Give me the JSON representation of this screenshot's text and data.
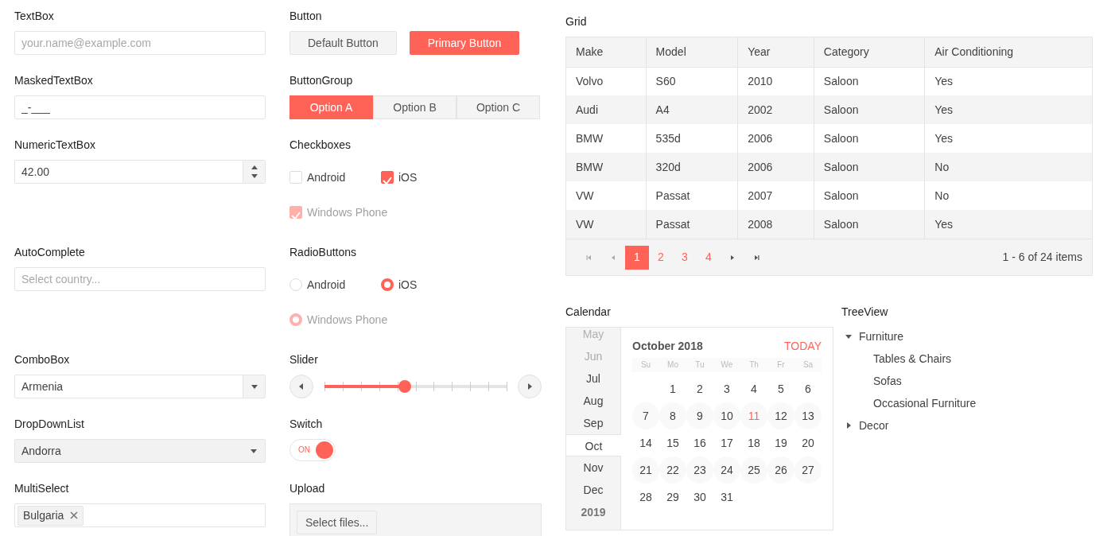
{
  "textbox": {
    "label": "TextBox",
    "placeholder": "your.name@example.com"
  },
  "button": {
    "label": "Button",
    "buttons": [
      {
        "text": "Default Button",
        "kind": "default"
      },
      {
        "text": "Primary Button",
        "kind": "primary"
      }
    ]
  },
  "masked_textbox": {
    "label": "MaskedTextBox",
    "value": "_-___"
  },
  "button_group": {
    "label": "ButtonGroup",
    "options": [
      {
        "text": "Option A",
        "selected": true
      },
      {
        "text": "Option B",
        "selected": false
      },
      {
        "text": "Option C",
        "selected": false
      }
    ]
  },
  "numeric_textbox": {
    "label": "NumericTextBox",
    "value": "42.00"
  },
  "checkboxes": {
    "label": "Checkboxes",
    "items": [
      {
        "text": "Android",
        "checked": false,
        "disabled": false
      },
      {
        "text": "iOS",
        "checked": true,
        "disabled": false
      },
      {
        "text": "Windows Phone",
        "checked": true,
        "disabled": true
      }
    ]
  },
  "autocomplete": {
    "label": "AutoComplete",
    "placeholder": "Select country..."
  },
  "radio_buttons": {
    "label": "RadioButtons",
    "items": [
      {
        "text": "Android",
        "selected": false,
        "disabled": false
      },
      {
        "text": "iOS",
        "selected": true,
        "disabled": false
      },
      {
        "text": "Windows Phone",
        "selected": true,
        "disabled": true
      }
    ]
  },
  "combobox": {
    "label": "ComboBox",
    "value": "Armenia"
  },
  "slider": {
    "label": "Slider",
    "level": 0.44
  },
  "dropdownlist": {
    "label": "DropDownList",
    "value": "Andorra"
  },
  "switch": {
    "label": "Switch",
    "on": true,
    "text": "ON"
  },
  "multiselect": {
    "label": "MultiSelect",
    "tags": [
      "Bulgaria"
    ]
  },
  "upload": {
    "label": "Upload",
    "button": "Select files..."
  },
  "grid": {
    "title": "Grid",
    "columns": [
      "Make",
      "Model",
      "Year",
      "Category",
      "Air Conditioning"
    ],
    "rows": [
      [
        "Volvo",
        "S60",
        "2010",
        "Saloon",
        "Yes"
      ],
      [
        "Audi",
        "A4",
        "2002",
        "Saloon",
        "Yes"
      ],
      [
        "BMW",
        "535d",
        "2006",
        "Saloon",
        "Yes"
      ],
      [
        "BMW",
        "320d",
        "2006",
        "Saloon",
        "No"
      ],
      [
        "VW",
        "Passat",
        "2007",
        "Saloon",
        "No"
      ],
      [
        "VW",
        "Passat",
        "2008",
        "Saloon",
        "Yes"
      ]
    ],
    "pager": {
      "pages": [
        {
          "text": "1",
          "selected": true
        },
        {
          "text": "2",
          "selected": false
        },
        {
          "text": "3",
          "selected": false
        },
        {
          "text": "4",
          "selected": false
        }
      ],
      "info": "1 - 6 of 24 items"
    }
  },
  "calendar": {
    "label": "Calendar",
    "months": [
      {
        "text": "May",
        "kind": "faded",
        "selected": false
      },
      {
        "text": "Jun",
        "kind": "dim",
        "selected": false
      },
      {
        "text": "Jul",
        "kind": "month",
        "selected": false
      },
      {
        "text": "Aug",
        "kind": "month",
        "selected": false
      },
      {
        "text": "Sep",
        "kind": "month",
        "selected": false
      },
      {
        "text": "Oct",
        "kind": "month",
        "selected": true
      },
      {
        "text": "Nov",
        "kind": "month",
        "selected": false
      },
      {
        "text": "Dec",
        "kind": "month",
        "selected": false
      },
      {
        "text": "2019",
        "kind": "year",
        "selected": false
      }
    ],
    "title": "October 2018",
    "today_link": "TODAY",
    "weekdays": [
      "Su",
      "Mo",
      "Tu",
      "We",
      "Th",
      "Fr",
      "Sa"
    ],
    "weeks": [
      [
        {
          "text": "1",
          "today": false
        },
        {
          "text": "2",
          "today": false
        },
        {
          "text": "3",
          "today": false
        },
        {
          "text": "4",
          "today": false
        },
        {
          "text": "5",
          "today": false
        },
        {
          "text": "6",
          "today": false
        }
      ],
      [
        {
          "text": "7",
          "today": false
        },
        {
          "text": "8",
          "today": false
        },
        {
          "text": "9",
          "today": false
        },
        {
          "text": "10",
          "today": false
        },
        {
          "text": "11",
          "today": true
        },
        {
          "text": "12",
          "today": false
        },
        {
          "text": "13",
          "today": false
        }
      ],
      [
        {
          "text": "14",
          "today": false
        },
        {
          "text": "15",
          "today": false
        },
        {
          "text": "16",
          "today": false
        },
        {
          "text": "17",
          "today": false
        },
        {
          "text": "18",
          "today": false
        },
        {
          "text": "19",
          "today": false
        },
        {
          "text": "20",
          "today": false
        }
      ],
      [
        {
          "text": "21",
          "today": false
        },
        {
          "text": "22",
          "today": false
        },
        {
          "text": "23",
          "today": false
        },
        {
          "text": "24",
          "today": false
        },
        {
          "text": "25",
          "today": false
        },
        {
          "text": "26",
          "today": false
        },
        {
          "text": "27",
          "today": false
        }
      ],
      [
        {
          "text": "28",
          "today": false
        },
        {
          "text": "29",
          "today": false
        },
        {
          "text": "30",
          "today": false
        },
        {
          "text": "31",
          "today": false
        }
      ]
    ]
  },
  "treeview": {
    "label": "TreeView",
    "items": [
      {
        "text": "Furniture",
        "expanded": true,
        "children": [
          {
            "text": "Tables & Chairs"
          },
          {
            "text": "Sofas"
          },
          {
            "text": "Occasional Furniture"
          }
        ]
      },
      {
        "text": "Decor",
        "expanded": false
      }
    ]
  }
}
